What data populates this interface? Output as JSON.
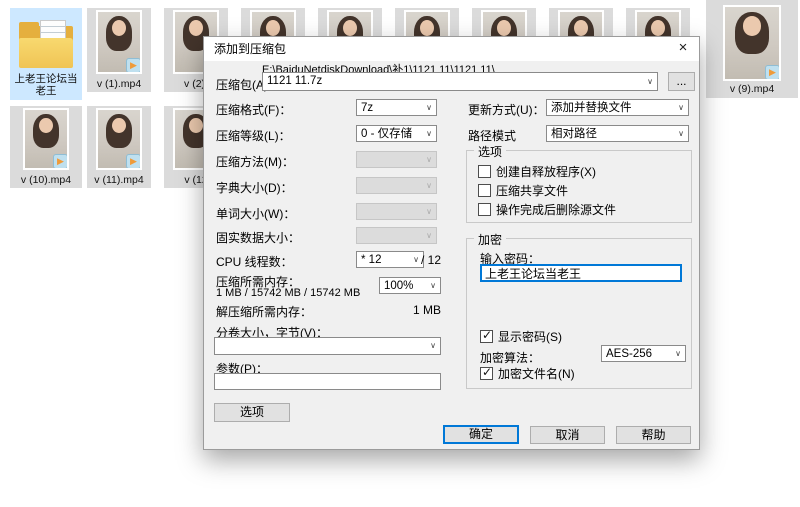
{
  "explorer": {
    "folder_name": "上老王论坛当老王",
    "videos": {
      "v1": "v (1).mp4",
      "v2": "v (2).",
      "v9": "v (9).mp4",
      "v10": "v (10).mp4",
      "v11": "v (11).mp4",
      "v12": "v (12"
    }
  },
  "dialog": {
    "title": "添加到压缩包",
    "close_icon": "×",
    "archive": {
      "label": "压缩包(A)：",
      "path": "E:\\BaiduNetdiskDownload\\补1\\1121 11\\1121 11\\",
      "name": "1121 11.7z",
      "browse": "..."
    },
    "fields": {
      "format": {
        "label": "压缩格式(F)：",
        "value": "7z"
      },
      "level": {
        "label": "压缩等级(L)：",
        "value": "0 - 仅存储"
      },
      "method": {
        "label": "压缩方法(M)："
      },
      "dict": {
        "label": "字典大小(D)："
      },
      "word": {
        "label": "单词大小(W)："
      },
      "solid": {
        "label": "固实数据大小："
      },
      "cpu": {
        "label": "CPU 线程数：",
        "value": "* 12",
        "suffix": "/ 12"
      },
      "mem": {
        "label": "压缩所需内存：",
        "detail": "1 MB / 15742 MB / 15742 MB",
        "percent": "100%"
      },
      "memde": {
        "label": "解压缩所需内存：",
        "value": "1 MB"
      },
      "volume": {
        "label": "分卷大小，字节(V)："
      },
      "params": {
        "label": "参数(P)："
      },
      "options_button": "选项"
    },
    "right": {
      "update": {
        "label": "更新方式(U)：",
        "value": "添加并替换文件"
      },
      "pathmode": {
        "label": "路径模式",
        "value": "相对路径"
      },
      "options_group": {
        "title": "选项",
        "cb_sfx": "创建自释放程序(X)",
        "cb_shared": "压缩共享文件",
        "cb_delete": "操作完成后删除源文件"
      },
      "encrypt_group": {
        "title": "加密",
        "password_label": "输入密码：",
        "password": "上老王论坛当老王",
        "show_password": "显示密码(S)",
        "algorithm_label": "加密算法：",
        "algorithm": "AES-256",
        "encrypt_names": "加密文件名(N)"
      }
    },
    "buttons": {
      "ok": "确定",
      "cancel": "取消",
      "help": "帮助"
    }
  }
}
